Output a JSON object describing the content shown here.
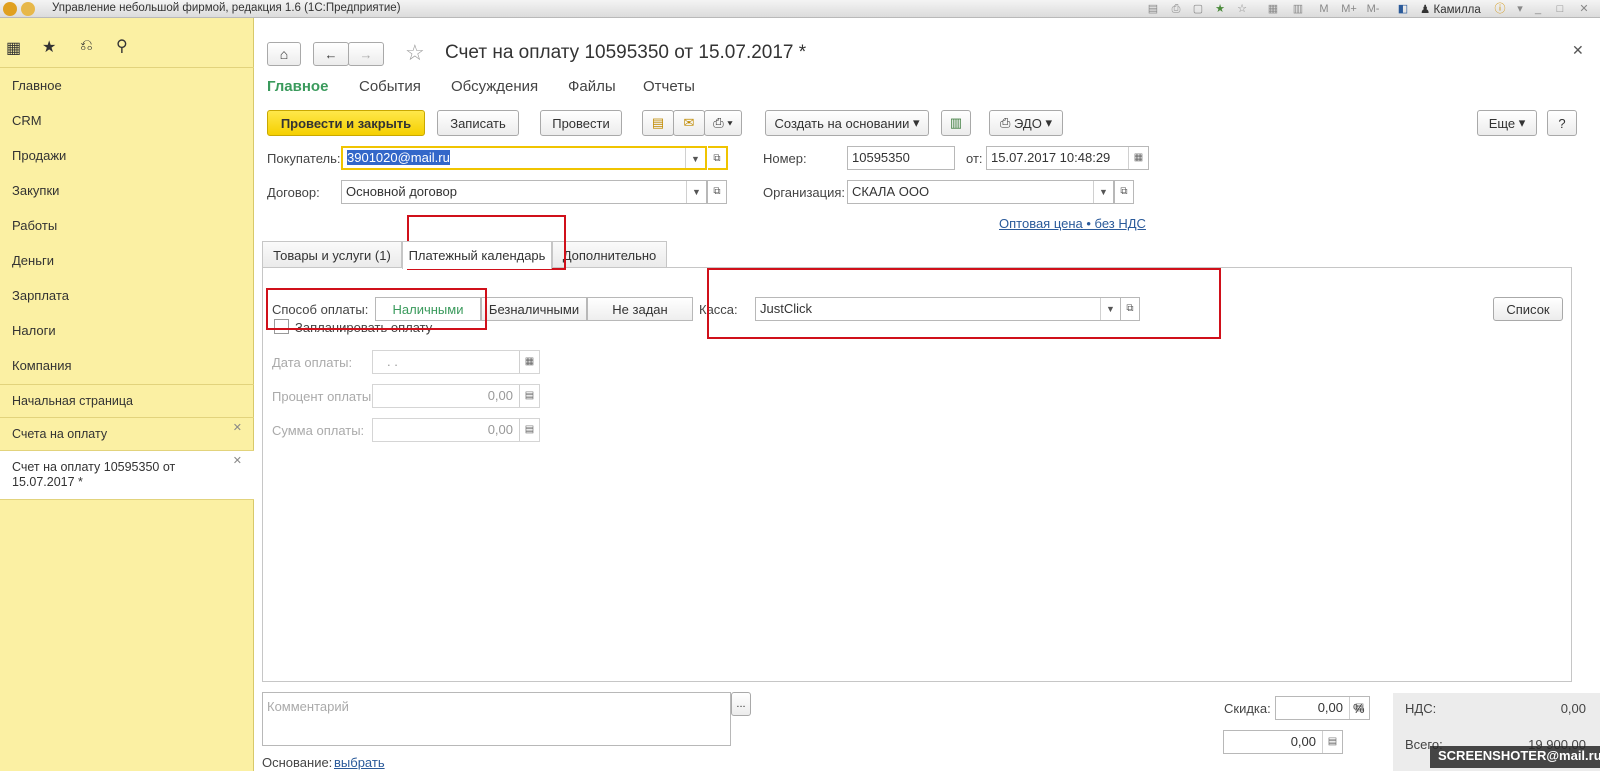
{
  "window": {
    "title": "Управление небольшой фирмой, редакция 1.6  (1С:Предприятие)",
    "user": "Камилла"
  },
  "sidebar": {
    "nav": [
      "Главное",
      "CRM",
      "Продажи",
      "Закупки",
      "Работы",
      "Деньги",
      "Зарплата",
      "Налоги",
      "Компания"
    ],
    "open_windows": [
      "Начальная страница",
      "Счета на оплату",
      "Счет на оплату 10595350 от\n15.07.2017 *"
    ]
  },
  "form": {
    "title": "Счет на оплату 10595350 от 15.07.2017 *",
    "tabs": [
      "Главное",
      "События",
      "Обсуждения",
      "Файлы",
      "Отчеты"
    ],
    "toolbar": {
      "post_close": "Провести и закрыть",
      "save": "Записать",
      "post": "Провести",
      "create_based": "Создать на основании",
      "edo": "ЭДО",
      "more": "Еще",
      "help": "?"
    },
    "buyer": {
      "label": "Покупатель:",
      "value": "3901020@mail.ru"
    },
    "number": {
      "label": "Номер:",
      "value": "10595350"
    },
    "date": {
      "label": "от:",
      "value": "15.07.2017 10:48:29"
    },
    "contract": {
      "label": "Договор:",
      "value": "Основной договор"
    },
    "organization": {
      "label": "Организация:",
      "value": "СКАЛА ООО"
    },
    "price_link": "Оптовая цена • без НДС",
    "page_tabs": [
      "Товары и услуги (1)",
      "Платежный календарь",
      "Дополнительно"
    ],
    "payment_method": {
      "label": "Способ оплаты:",
      "options": [
        "Наличными",
        "Безналичными",
        "Не задан"
      ],
      "selected": "Наличными"
    },
    "cash": {
      "label": "Касса:",
      "value": "JustClick"
    },
    "list_button": "Список",
    "plan_payment": "Запланировать оплату",
    "pay_date": {
      "label": "Дата оплаты:",
      "value": " .  ."
    },
    "pay_percent": {
      "label": "Процент оплаты:",
      "value": "0,00"
    },
    "pay_sum": {
      "label": "Сумма оплаты:",
      "value": "0,00"
    },
    "comment_placeholder": "Комментарий",
    "comment_more": "...",
    "discount": {
      "label": "Скидка:",
      "value": "0,00",
      "unit": "%"
    },
    "discount_sum": "0,00",
    "vat": {
      "label": "НДС:",
      "value": "0,00"
    },
    "total": {
      "label": "Всего:",
      "value": "19 900,00"
    },
    "basis": {
      "label": "Основание:",
      "link": "выбрать"
    }
  },
  "watermark": "SCREENSHOTER@mail.ru",
  "colors": {
    "accent_yellow": "#f5d000",
    "sidebar_bg": "#fbf0a3",
    "active_tab_green": "#3a9a5c",
    "highlight_red": "#d0101a"
  }
}
